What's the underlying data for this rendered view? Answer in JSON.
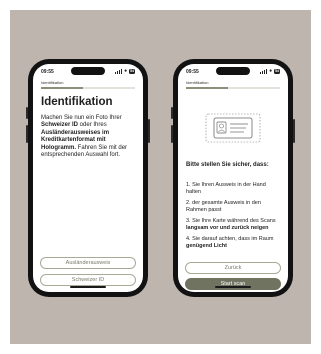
{
  "status_bar": {
    "time": "09:55",
    "battery": "54"
  },
  "screen1": {
    "step_label": "Identifikation",
    "progress": 0.45,
    "title": "Identifikation",
    "description": [
      {
        "text": "Machen Sie nun ein Foto Ihrer ",
        "bold": false
      },
      {
        "text": "Schweizer ID",
        "bold": true
      },
      {
        "text": " oder Ihres ",
        "bold": false
      },
      {
        "text": "Ausländerausweises im Kreditkartenformat mit Hologramm.",
        "bold": true
      },
      {
        "text": " Fahren Sie mit der entsprechenden Auswahl fort.",
        "bold": false
      }
    ],
    "buttons": {
      "foreigner_id": "Ausländerausweis",
      "swiss_id": "Schweizer ID"
    }
  },
  "screen2": {
    "step_label": "Identifikation",
    "progress": 0.45,
    "tips_title": "Bitte stellen Sie sicher, dass:",
    "tips": [
      [
        {
          "text": "1. Sie Ihren Ausweis in der Hand halten",
          "bold": false
        }
      ],
      [
        {
          "text": "2. der gesamte Ausweis in den Rahmen passt",
          "bold": false
        }
      ],
      [
        {
          "text": "3. Sie Ihre Karte während des Scans ",
          "bold": false
        },
        {
          "text": "langsam vor und zurück neigen",
          "bold": true
        }
      ],
      [
        {
          "text": "4. Sie darauf achten, dass im Raum ",
          "bold": false
        },
        {
          "text": "genügend Licht",
          "bold": true
        }
      ]
    ],
    "buttons": {
      "back": "Zurück",
      "start": "Start scan"
    }
  },
  "colors": {
    "background": "#bdb5ae",
    "accent": "#6f7360",
    "outline": "#a7aa97",
    "progress_track": "#e3e1da",
    "progress_fill": "#8b8e78"
  },
  "icons": {
    "signal": "signal-icon",
    "wifi": "wifi-icon",
    "battery": "battery-icon",
    "id_card": "id-card-icon"
  }
}
